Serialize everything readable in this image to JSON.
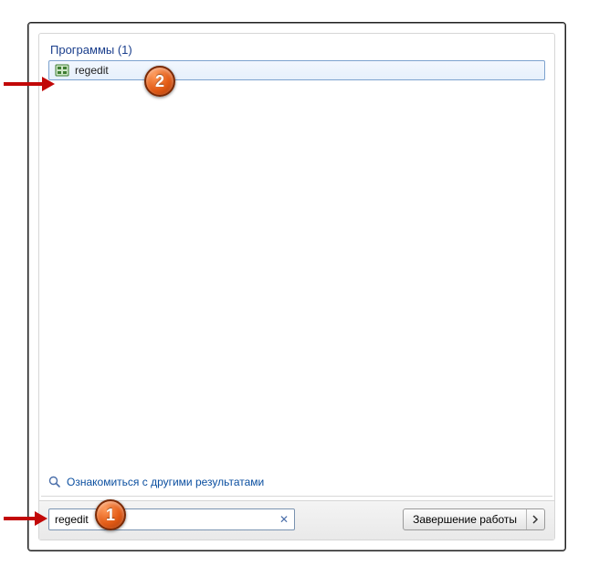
{
  "results": {
    "category_label": "Программы (1)",
    "items": [
      {
        "label": "regedit",
        "icon": "regedit-icon"
      }
    ]
  },
  "more_results_label": "Ознакомиться с другими результатами",
  "search": {
    "value": "regedit",
    "placeholder": ""
  },
  "shutdown": {
    "label": "Завершение работы"
  },
  "annotations": {
    "badge1": "1",
    "badge2": "2"
  }
}
